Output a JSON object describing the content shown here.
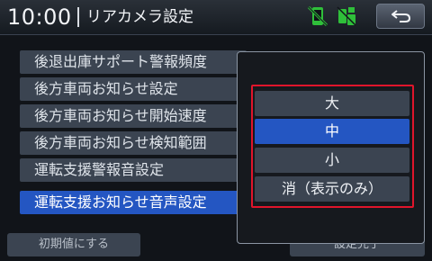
{
  "header": {
    "clock": "10:00",
    "title": "リアカメラ設定",
    "icons": [
      "phone-disconnected-icon",
      "phone-battery-icon",
      "back-arrow-icon"
    ]
  },
  "menu": {
    "items": [
      {
        "label": "後退出庫サポート警報頻度"
      },
      {
        "label": "後方車両お知らせ設定"
      },
      {
        "label": "後方車両お知らせ開始速度"
      },
      {
        "label": "後方車両お知らせ検知範囲"
      },
      {
        "label": "運転支援警報音設定"
      },
      {
        "label": "運転支援お知らせ音声設定"
      }
    ],
    "selected_index": 5
  },
  "bottom": {
    "reset_label": "初期値にする",
    "done_label": "設定完了"
  },
  "popup": {
    "options": [
      {
        "label": "大"
      },
      {
        "label": "中"
      },
      {
        "label": "小"
      },
      {
        "label": "消（表示のみ）"
      }
    ],
    "selected_index": 1
  },
  "colors": {
    "accent": "#2456c2",
    "highlight_frame": "#e0152b",
    "status_icon": "#2fbf3a"
  }
}
